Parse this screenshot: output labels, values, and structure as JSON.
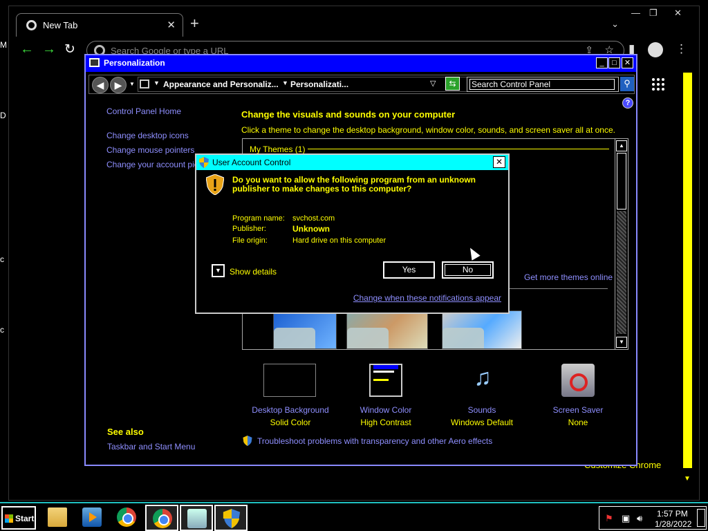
{
  "chrome": {
    "tab_title": "New Tab",
    "tab_close": "✕",
    "new_tab": "+",
    "tab_dropdown": "⌄",
    "win_minimize": "—",
    "win_restore": "❐",
    "win_close": "✕",
    "back": "←",
    "forward": "→",
    "reload": "↻",
    "omnibox_placeholder": "Search Google or type a URL",
    "customize_label": "Customize Chrome",
    "left_edge_chars": [
      "M",
      "D",
      "c",
      "c"
    ]
  },
  "personalization": {
    "title": "Personalization",
    "minimize": "_",
    "maximize": "□",
    "close": "✕",
    "breadcrumb": [
      "Appearance and Personaliz...",
      "Personalizati..."
    ],
    "search_placeholder": "Search Control Panel",
    "help": "?",
    "sidebar": {
      "home": "Control Panel Home",
      "links": [
        "Change desktop icons",
        "Change mouse pointers",
        "Change your account pictu"
      ],
      "see_also_title": "See also",
      "see_also_links": [
        "Taskbar and Start Menu"
      ]
    },
    "heading": "Change the visuals and sounds on your computer",
    "subheading": "Click a theme to change the desktop background, window color, sounds, and screen saver all at once.",
    "themes_section": "My Themes (1)",
    "get_more_themes": "Get more themes online",
    "options": [
      {
        "name": "Desktop Background",
        "value": "Solid Color"
      },
      {
        "name": "Window Color",
        "value": "High Contrast"
      },
      {
        "name": "Sounds",
        "value": "Windows Default"
      },
      {
        "name": "Screen Saver",
        "value": "None"
      }
    ],
    "troubleshoot_link": "Troubleshoot problems with transparency and other Aero effects"
  },
  "uac": {
    "title": "User Account Control",
    "close": "✕",
    "question": "Do you want to allow the following program from an unknown publisher to make changes to this computer?",
    "fields": [
      {
        "label": "Program name:",
        "value": "svchost.com",
        "bold": false
      },
      {
        "label": "Publisher:",
        "value": "Unknown",
        "bold": true
      },
      {
        "label": "File origin:",
        "value": "Hard drive on this computer",
        "bold": false
      }
    ],
    "show_details": "Show details",
    "yes": "Yes",
    "no": "No",
    "notify_link": "Change when these notifications appear"
  },
  "taskbar": {
    "start": "Start",
    "time": "1:57 PM",
    "date": "1/28/2022"
  },
  "colors": {
    "uac_title": "#00ffff",
    "cp_title": "#0000ff",
    "link": "#8f8fff",
    "text_highlight": "#ffff00"
  }
}
